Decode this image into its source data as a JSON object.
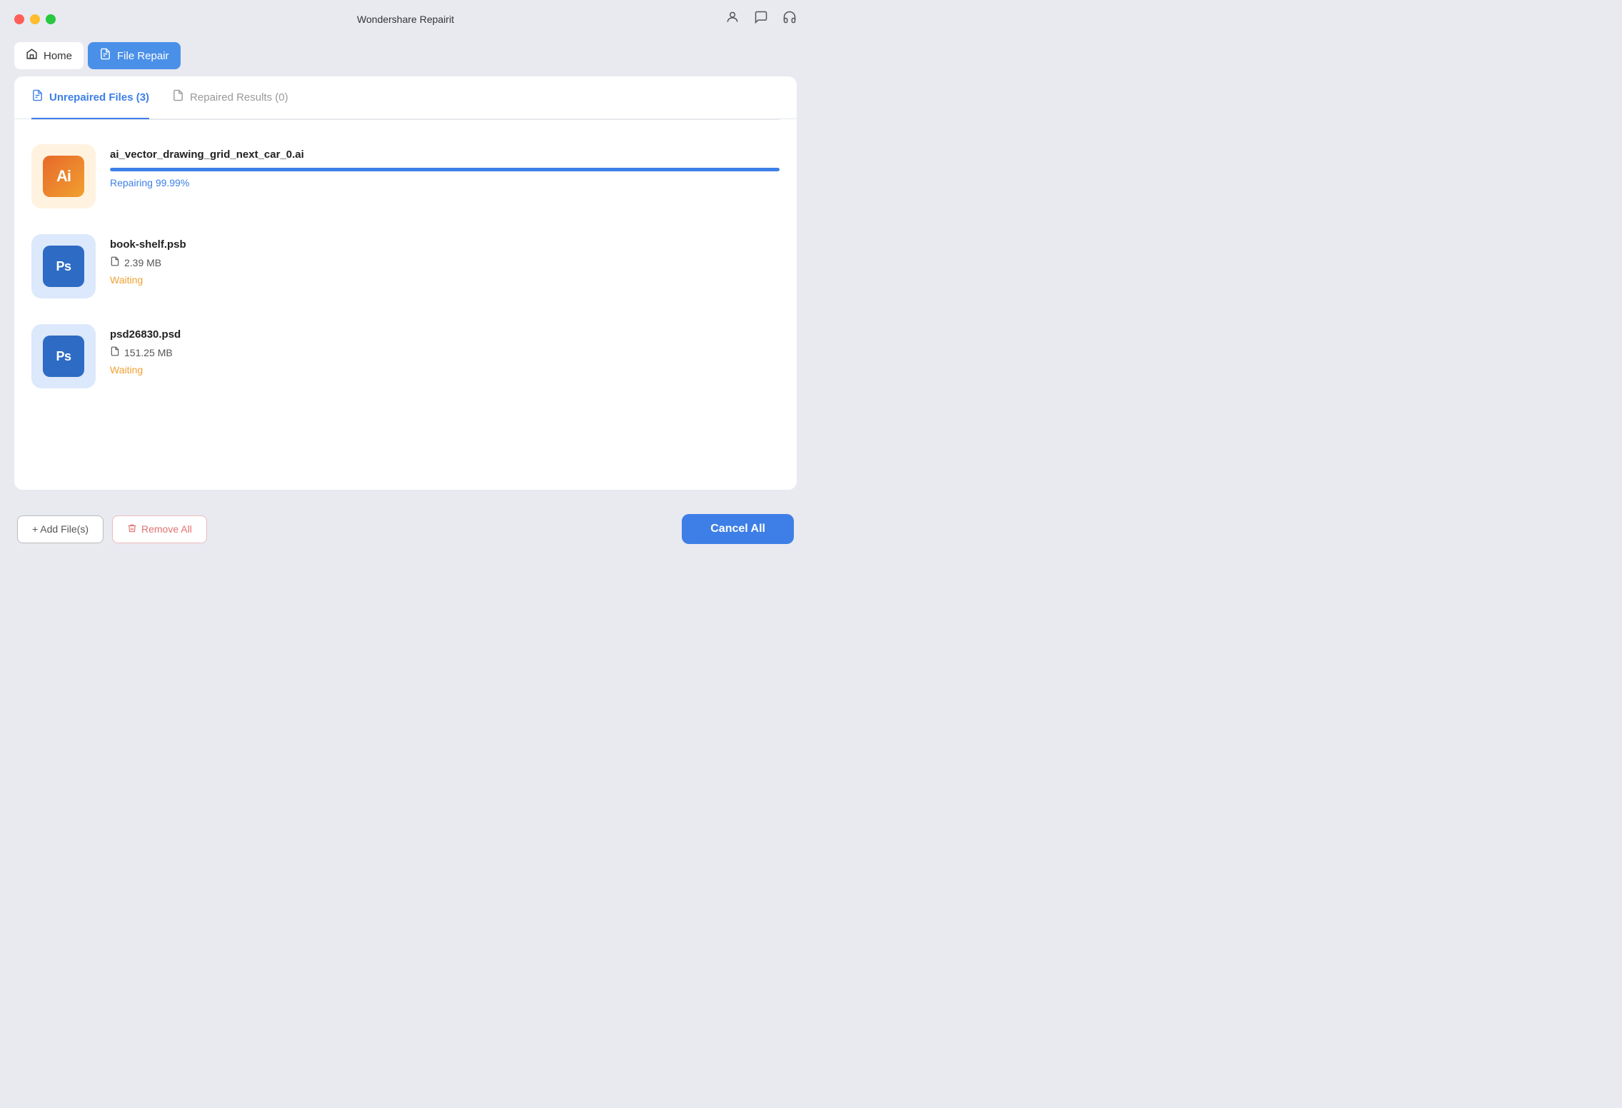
{
  "window": {
    "title": "Wondershare Repairit"
  },
  "nav": {
    "home_label": "Home",
    "file_repair_label": "File Repair"
  },
  "tabs": {
    "unrepaired_label": "Unrepaired Files (3)",
    "repaired_label": "Repaired Results (0)"
  },
  "files": [
    {
      "id": "file-1",
      "name": "ai_vector_drawing_grid_next_car_0.ai",
      "type": "ai",
      "icon_label": "Ai",
      "size": null,
      "progress": 99.99,
      "status": "Repairing 99.99%",
      "status_type": "repairing"
    },
    {
      "id": "file-2",
      "name": "book-shelf.psb",
      "type": "ps",
      "icon_label": "Ps",
      "size": "2.39 MB",
      "progress": null,
      "status": "Waiting",
      "status_type": "waiting"
    },
    {
      "id": "file-3",
      "name": "psd26830.psd",
      "type": "ps",
      "icon_label": "Ps",
      "size": "151.25 MB",
      "progress": null,
      "status": "Waiting",
      "status_type": "waiting"
    }
  ],
  "buttons": {
    "add_files": "+ Add File(s)",
    "remove_all": "Remove All",
    "cancel_all": "Cancel All"
  },
  "colors": {
    "blue_accent": "#3d7fe6",
    "waiting_orange": "#f0a030",
    "progress_blue": "#3d7fe6"
  }
}
